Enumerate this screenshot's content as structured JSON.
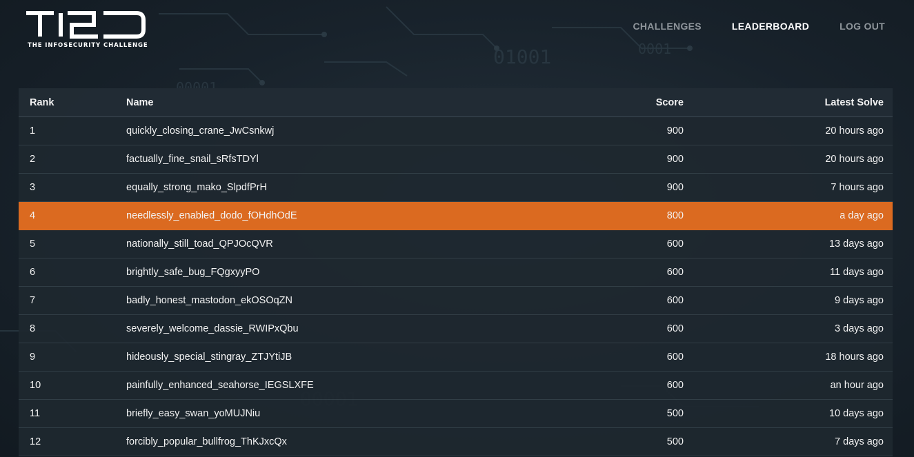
{
  "brand": {
    "tagline": "THE INFOSECURITY CHALLENGE",
    "accent_color": "#db6a20"
  },
  "nav": {
    "items": [
      {
        "label": "CHALLENGES",
        "active": false
      },
      {
        "label": "LEADERBOARD",
        "active": true
      },
      {
        "label": "LOG OUT",
        "active": false
      }
    ]
  },
  "leaderboard": {
    "columns": [
      "Rank",
      "Name",
      "Score",
      "Latest Solve"
    ],
    "rows": [
      {
        "rank": "1",
        "name": "quickly_closing_crane_JwCsnkwj",
        "score": "900",
        "latest_solve": "20 hours ago",
        "highlighted": false
      },
      {
        "rank": "2",
        "name": "factually_fine_snail_sRfsTDYl",
        "score": "900",
        "latest_solve": "20 hours ago",
        "highlighted": false
      },
      {
        "rank": "3",
        "name": "equally_strong_mako_SlpdfPrH",
        "score": "900",
        "latest_solve": "7 hours ago",
        "highlighted": false
      },
      {
        "rank": "4",
        "name": "needlessly_enabled_dodo_fOHdhOdE",
        "score": "800",
        "latest_solve": "a day ago",
        "highlighted": true
      },
      {
        "rank": "5",
        "name": "nationally_still_toad_QPJOcQVR",
        "score": "600",
        "latest_solve": "13 days ago",
        "highlighted": false
      },
      {
        "rank": "6",
        "name": "brightly_safe_bug_FQgxyyPO",
        "score": "600",
        "latest_solve": "11 days ago",
        "highlighted": false
      },
      {
        "rank": "7",
        "name": "badly_honest_mastodon_ekOSOqZN",
        "score": "600",
        "latest_solve": "9 days ago",
        "highlighted": false
      },
      {
        "rank": "8",
        "name": "severely_welcome_dassie_RWIPxQbu",
        "score": "600",
        "latest_solve": "3 days ago",
        "highlighted": false
      },
      {
        "rank": "9",
        "name": "hideously_special_stingray_ZTJYtiJB",
        "score": "600",
        "latest_solve": "18 hours ago",
        "highlighted": false
      },
      {
        "rank": "10",
        "name": "painfully_enhanced_seahorse_IEGSLXFE",
        "score": "600",
        "latest_solve": "an hour ago",
        "highlighted": false
      },
      {
        "rank": "11",
        "name": "briefly_easy_swan_yoMUJNiu",
        "score": "500",
        "latest_solve": "10 days ago",
        "highlighted": false
      },
      {
        "rank": "12",
        "name": "forcibly_popular_bullfrog_ThKJxcQx",
        "score": "500",
        "latest_solve": "7 days ago",
        "highlighted": false
      }
    ]
  }
}
